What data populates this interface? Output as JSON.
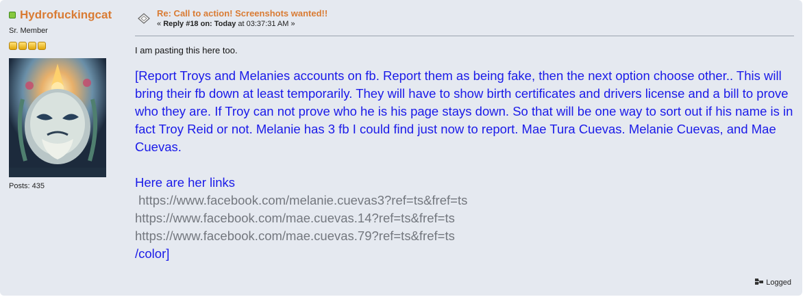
{
  "poster": {
    "name": "Hydrofuckingcat",
    "member_title": "Sr. Member",
    "star_count": 4,
    "posts": "Posts: 435"
  },
  "post": {
    "subject": "Re: Call to action! Screenshots wanted!!",
    "reply_prefix": "« ",
    "reply_label": "Reply #18 on:",
    "reply_when": "Today",
    "reply_time": " at 03:37:31 AM »"
  },
  "body": {
    "intro": "I am pasting this here too.",
    "quote": "[Report Troys and Melanies accounts on fb. Report them as being fake, then the next option choose other.. This will bring their fb down at least temporarily. They will have to show birth certificates and drivers license and a bill to prove who they are. If Troy can not prove who he is his page stays down. So that will be one way to sort out if his name is in fact Troy Reid or not.  Melanie has 3 fb I could find just now to report. Mae Tura Cuevas. Melanie Cuevas, and Mae Cuevas.",
    "links_title": "Here are her links",
    "links": [
      " https://www.facebook.com/melanie.cuevas3?ref=ts&fref=ts",
      "https://www.facebook.com/mae.cuevas.14?ref=ts&fref=ts",
      "https://www.facebook.com/mae.cuevas.79?ref=ts&fref=ts"
    ],
    "closing": "/color]"
  },
  "footer": {
    "logged": "Logged"
  },
  "colors": {
    "post_bg": "#e5e9f0",
    "name": "#d97b33",
    "quote_text": "#1a1ae8",
    "link_text": "#73777e",
    "online_dot": "#87c840"
  }
}
